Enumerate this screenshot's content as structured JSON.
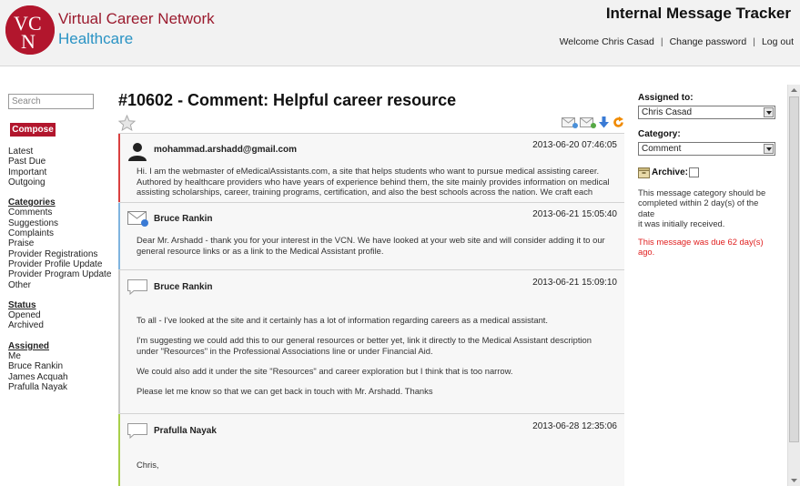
{
  "header": {
    "brand_line1": "Virtual Career Network",
    "brand_line2": "Healthcare",
    "app_title": "Internal Message Tracker",
    "welcome": "Welcome Chris Casad",
    "change_password": "Change password",
    "logout": "Log out"
  },
  "sidebar": {
    "search_placeholder": "Search",
    "compose_label": "Compose",
    "views": [
      "Latest",
      "Past Due",
      "Important",
      "Outgoing"
    ],
    "categories_header": "Categories",
    "categories": [
      "Comments",
      "Suggestions",
      "Complaints",
      "Praise",
      "Provider Registrations",
      "Provider Profile Update",
      "Provider Program Update",
      "Other"
    ],
    "status_header": "Status",
    "status": [
      "Opened",
      "Archived"
    ],
    "assigned_header": "Assigned",
    "assigned": [
      "Me",
      "Bruce Rankin",
      "James Acquah",
      "Prafulla Nayak"
    ]
  },
  "message": {
    "title": "#10602 - Comment: Helpful career resource"
  },
  "thread": [
    {
      "sender": "mohammad.arshadd@gmail.com",
      "time": "2013-06-20 07:46:05",
      "body": [
        "Hi. I am the webmaster of eMedicalAssistants.com, a site that helps students who want to pursue medical assisting career.\nAuthored by healthcare providers who have years of experience behind them, the site mainly provides information on medical\nassisting scholarships, career, training programs, certification, and also the best schools across the nation. We craft each"
      ]
    },
    {
      "sender": "Bruce Rankin",
      "time": "2013-06-21 15:05:40",
      "body": [
        "Dear Mr. Arshadd - thank you for your interest in the VCN. We have looked at your web site and will consider adding it to our\ngeneral resource links or as a link to the Medical Assistant profile."
      ]
    },
    {
      "sender": "Bruce Rankin",
      "time": "2013-06-21 15:09:10",
      "body": [
        "To all - I've looked at the site and it certainly has a lot of information regarding careers as a medical assistant.",
        "I'm suggesting we could add this to our general resources or better yet, link it directly to the Medical Assistant description\nunder \"Resources\" in the Professional Associations line or under Financial Aid.",
        "We could also add it under the site \"Resources\" and career exploration but I think that is too narrow.",
        "Please let me know so that we can get back in touch with Mr. Arshadd. Thanks"
      ]
    },
    {
      "sender": "Prafulla Nayak",
      "time": "2013-06-28 12:35:06",
      "body": [
        "Chris,"
      ]
    }
  ],
  "right_panel": {
    "assigned_label": "Assigned to:",
    "assigned_value": "Chris Casad",
    "category_label": "Category:",
    "category_value": "Comment",
    "archive_label": "Archive:",
    "completion_note": "This message category should be\ncompleted within 2 day(s) of the date\nit was initially received.",
    "due_note": "This message was due 62 day(s)\nago."
  },
  "colors": {
    "brand_red": "#b2162d",
    "brand_blue": "#2a93c4",
    "bar_red": "#d94040",
    "bar_blue": "#7fb4df",
    "bar_gray": "#c8c8c8",
    "bar_green": "#a8cf4a",
    "due_red": "#e02020"
  },
  "icons": {
    "star": "star-icon",
    "toolbar": [
      "forward-mail-icon",
      "add-mail-icon",
      "download-arrow-icon",
      "refresh-icon"
    ],
    "archive": "archive-box-icon"
  }
}
